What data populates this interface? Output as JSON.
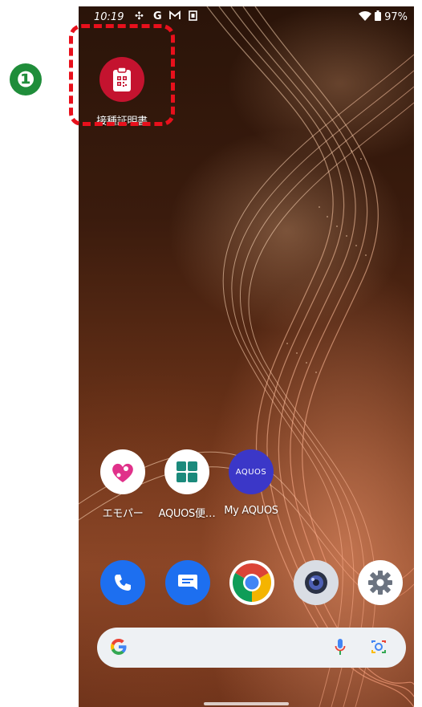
{
  "annotation": {
    "step_number": "❶",
    "highlight_color": "#e8101c",
    "badge_color": "#1f8d3a"
  },
  "status_bar": {
    "time": "10:19",
    "notification_icons": [
      "fan-notification-icon",
      "google-icon",
      "gmail-icon",
      "sim-card-icon"
    ],
    "wifi_icon": "wifi-icon",
    "battery_icon": "battery-icon",
    "battery_percent": "97%"
  },
  "home_screen": {
    "top_app": {
      "label": "接種証明書",
      "icon": "vaccine-certificate-icon",
      "color": "#c4132f"
    },
    "apps": [
      {
        "label": "エモパー",
        "icon": "heart-icon"
      },
      {
        "label": "AQUOS便…",
        "icon": "grid-icon"
      },
      {
        "label": "My AQUOS",
        "icon": "aquos-icon",
        "icon_text": "AQUOS",
        "color": "#3b37c8"
      }
    ],
    "dock": [
      {
        "name": "phone-app",
        "icon": "phone-icon",
        "color": "#1d6ff0"
      },
      {
        "name": "messages-app",
        "icon": "message-icon",
        "color": "#1d6ff0"
      },
      {
        "name": "chrome-app",
        "icon": "chrome-icon"
      },
      {
        "name": "camera-app",
        "icon": "camera-icon"
      },
      {
        "name": "settings-app",
        "icon": "gear-icon"
      }
    ]
  },
  "search_bar": {
    "logo": "google-g-icon",
    "mic_icon": "mic-icon",
    "lens_icon": "lens-icon"
  }
}
